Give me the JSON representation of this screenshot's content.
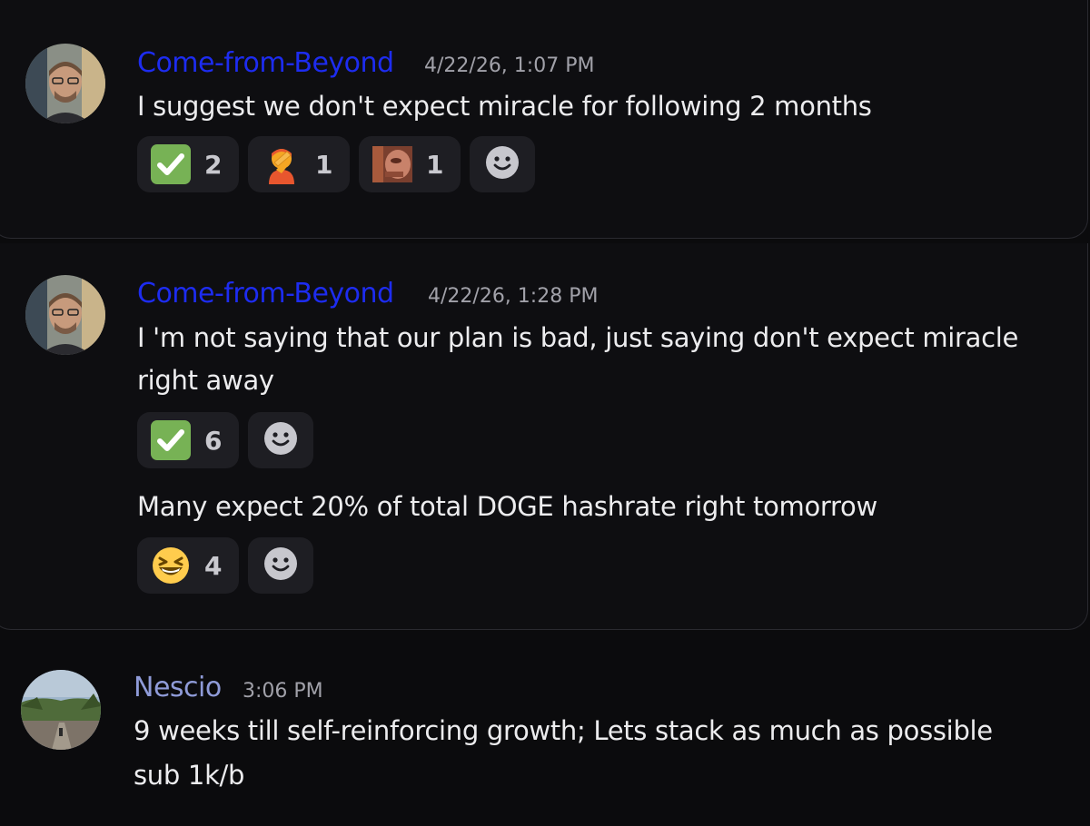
{
  "colors": {
    "background": "#0b0b0d",
    "card_background": "#0e0e11",
    "card_border": "#2a2a30",
    "reaction_background": "#1e1e23",
    "username_come_from_beyond": "#1d2cf0",
    "username_nescio": "#8f9bd8",
    "timestamp": "#a1a1a9",
    "text": "#ececee"
  },
  "messages": [
    {
      "author": "Come-from-Beyond",
      "timestamp": "4/22/26, 1:07 PM",
      "lines": [
        "I suggest we don't expect miracle for following 2 months"
      ],
      "reactions": [
        {
          "emoji": "check-mark-button-icon",
          "count": "2"
        },
        {
          "emoji": "person-facepalming-icon",
          "count": "1"
        },
        {
          "emoji": "custom-face-emoji-icon",
          "count": "1"
        }
      ],
      "add_reaction": "add-reaction-icon"
    },
    {
      "author": "Come-from-Beyond",
      "timestamp": "4/22/26, 1:28 PM",
      "lines": [
        "I 'm not saying that our plan is bad, just saying don't expect miracle",
        "right away"
      ],
      "reactions": [
        {
          "emoji": "check-mark-button-icon",
          "count": "6"
        }
      ],
      "add_reaction": "add-reaction-icon",
      "followup": {
        "text": "Many expect 20% of total DOGE hashrate right tomorrow",
        "reactions": [
          {
            "emoji": "grinning-squinting-face-icon",
            "count": "4"
          }
        ],
        "add_reaction": "add-reaction-icon"
      }
    },
    {
      "author": "Nescio",
      "timestamp": "3:06 PM",
      "lines": [
        "9 weeks till self-reinforcing growth; Lets stack as much as possible",
        "sub 1k/b"
      ]
    }
  ]
}
